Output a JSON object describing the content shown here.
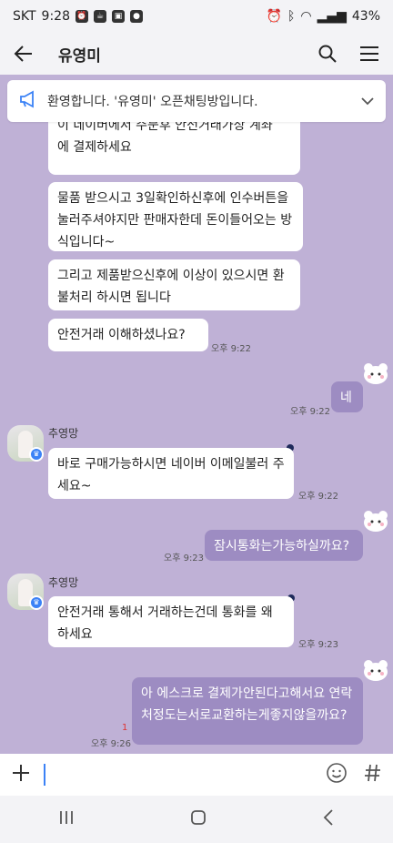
{
  "status_bar": {
    "carrier": "SKT",
    "time": "9:28",
    "battery": "43%"
  },
  "header": {
    "title": "유영미"
  },
  "notice": {
    "text": "환영합니다. '유영미' 오픈채팅방입니다."
  },
  "messages": [
    {
      "text": "에 결제하세요",
      "text_top": "이 네이버에서 주문후 안전거래가상 계좌"
    },
    {
      "text": "물품 받으시고 3일확인하신후에 인수버튼을 눌러주셔야지만 판매자한데 돈이들어오는 방식입니다~"
    },
    {
      "text": "그리고 제품받으신후에 이상이 있으시면 환불처리 하시면 됩니다"
    },
    {
      "text": "안전거래 이해하셨나요?",
      "time": "오후 9:22"
    },
    {
      "text": "네",
      "time": "오후 9:22"
    },
    {
      "sender": "추영망",
      "text": "바로 구매가능하시면 네이버 이메일불러 주세요~",
      "time": "오후 9:22"
    },
    {
      "text": "잠시통화는가능하실까요?",
      "time": "오후 9:23"
    },
    {
      "sender": "추영망",
      "text": "안전거래 통해서 거래하는건데 통화를 왜 하세요",
      "time": "오후 9:23"
    },
    {
      "text": "아 에스크로 결제가안된다고해서요 연락처정도는서로교환하는게좋지않을까요?",
      "time": "오후 9:26",
      "unread": "1"
    }
  ],
  "icons": {
    "back": "back-arrow-icon",
    "search": "search-icon",
    "menu": "menu-icon",
    "notice": "megaphone-icon",
    "plus": "plus-icon",
    "emoji": "emoji-icon",
    "hash": "hash-icon"
  },
  "colors": {
    "background": "#bfb1d6",
    "my_bubble": "#9d8cc2",
    "their_bubble": "#ffffff"
  }
}
